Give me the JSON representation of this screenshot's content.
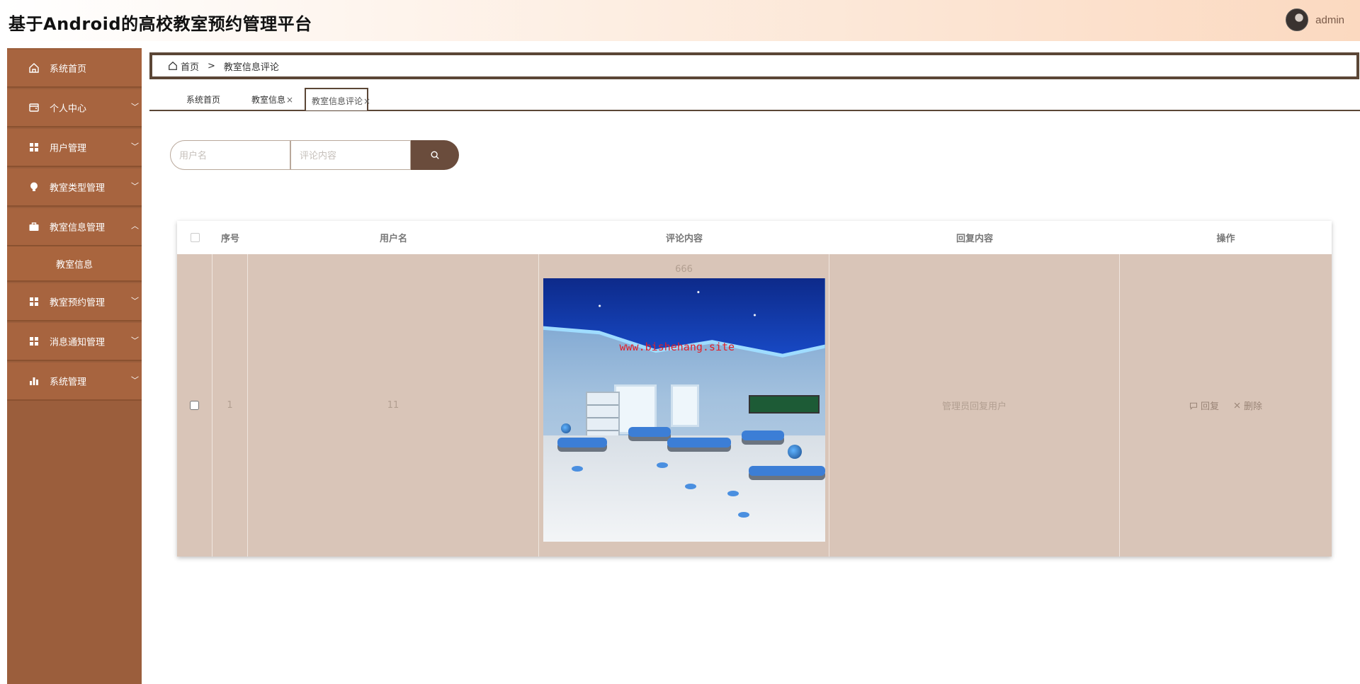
{
  "header": {
    "title": "基于Android的高校教室预约管理平台",
    "user": "admin"
  },
  "sidebar": {
    "items": [
      {
        "label": "系统首页",
        "icon": "home-icon"
      },
      {
        "label": "个人中心",
        "icon": "wallet-icon"
      },
      {
        "label": "用户管理",
        "icon": "grid-icon"
      },
      {
        "label": "教室类型管理",
        "icon": "bulb-icon"
      },
      {
        "label": "教室信息管理",
        "icon": "briefcase-icon"
      },
      {
        "label": "教室预约管理",
        "icon": "grid-icon"
      },
      {
        "label": "消息通知管理",
        "icon": "grid-icon"
      },
      {
        "label": "系统管理",
        "icon": "bar-chart-icon"
      }
    ],
    "submenu": {
      "label": "教室信息"
    }
  },
  "breadcrumb": {
    "home": "首页",
    "separator": ">",
    "current": "教室信息评论"
  },
  "tabs": [
    {
      "label": "系统首页",
      "closable": false
    },
    {
      "label": "教室信息",
      "closable": true
    },
    {
      "label": "教室信息评论",
      "closable": true
    }
  ],
  "tab_close": "×",
  "search": {
    "username_placeholder": "用户名",
    "content_placeholder": "评论内容"
  },
  "table": {
    "headers": {
      "index": "序号",
      "username": "用户名",
      "comment": "评论内容",
      "reply": "回复内容",
      "actions": "操作"
    },
    "rows": [
      {
        "index": "1",
        "username": "11",
        "comment": "666",
        "reply": "管理员回复用户",
        "image_watermark": "www.bishehang.site"
      }
    ],
    "reply_action": "回复",
    "delete_action": "删除"
  },
  "colors": {
    "sidebar": "#a7643f",
    "accent": "#6a4c3c",
    "row_bg": "#d9c5b8"
  }
}
